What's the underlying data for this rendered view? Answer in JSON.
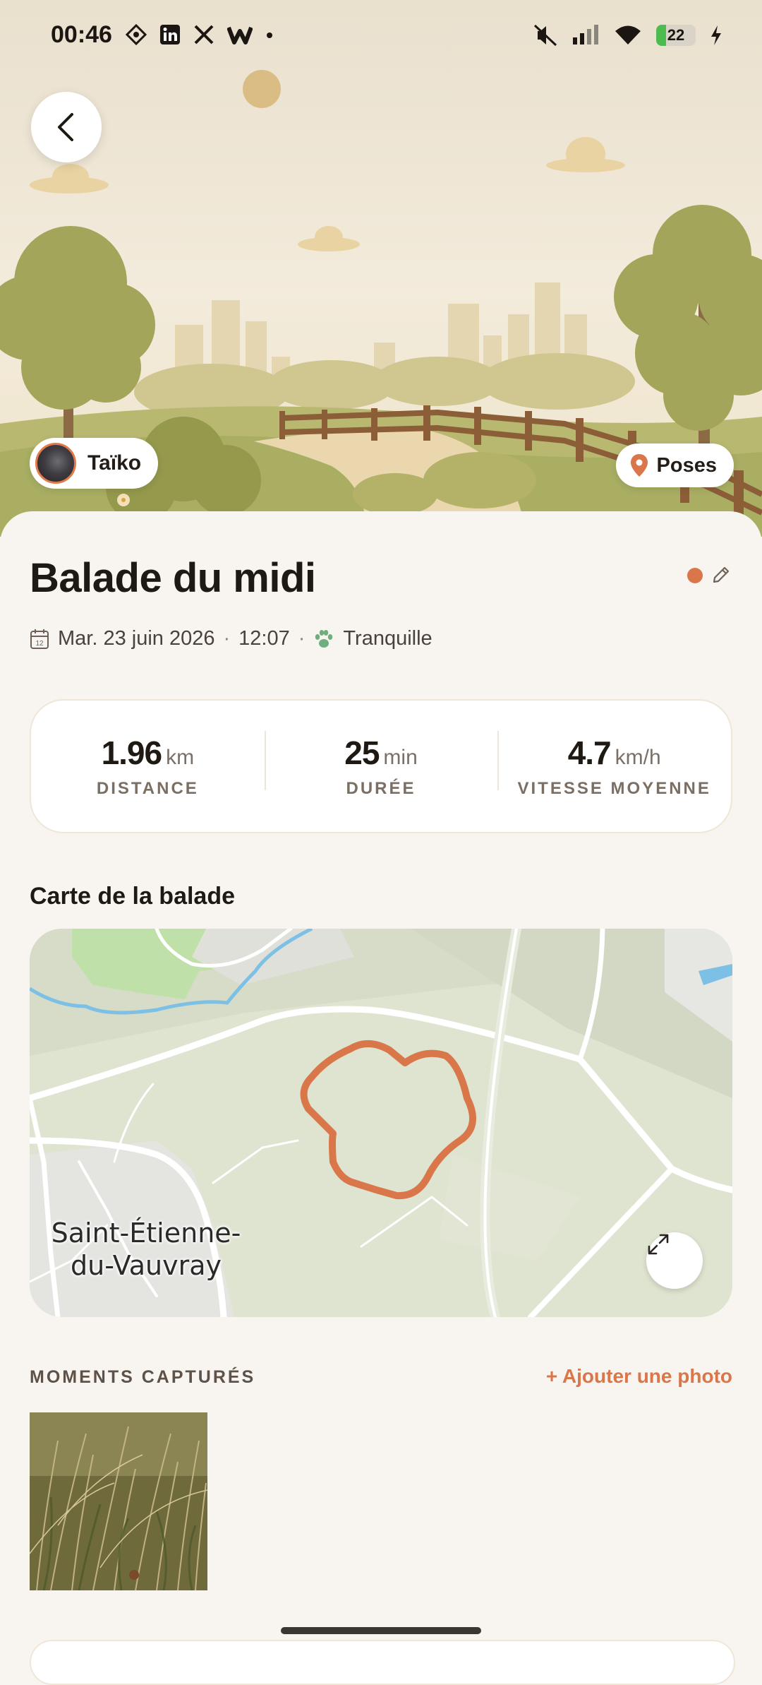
{
  "status_bar": {
    "time": "00:46",
    "battery_level": "22",
    "left_icons": [
      "app-diamond-icon",
      "linkedin-icon",
      "x-icon",
      "w-app-icon",
      "dot-icon"
    ],
    "right_icons": [
      "mute-icon",
      "signal-icon",
      "wifi-icon",
      "battery-icon",
      "charging-icon"
    ]
  },
  "hero": {
    "dog_name": "Taïko",
    "poses_label": "Poses"
  },
  "walk": {
    "title": "Balade du midi",
    "date": "Mar. 23 juin 2026",
    "time": "12:07",
    "pace": "Tranquille"
  },
  "stats": [
    {
      "value": "1.96",
      "unit": "km",
      "label": "DISTANCE"
    },
    {
      "value": "25",
      "unit": "min",
      "label": "DURÉE"
    },
    {
      "value": "4.7",
      "unit": "km/h",
      "label": "VITESSE MOYENNE"
    }
  ],
  "map_section": {
    "title": "Carte de la balade",
    "place_line1": "Saint-Étienne-",
    "place_line2": "du-Vauvray"
  },
  "moments": {
    "title": "MOMENTS CAPTURÉS",
    "add_label": "+ Ajouter une photo"
  },
  "colors": {
    "accent": "#d9774a",
    "background": "#f8f5f0",
    "text_primary": "#1f1914",
    "map_route": "#d9774a"
  }
}
